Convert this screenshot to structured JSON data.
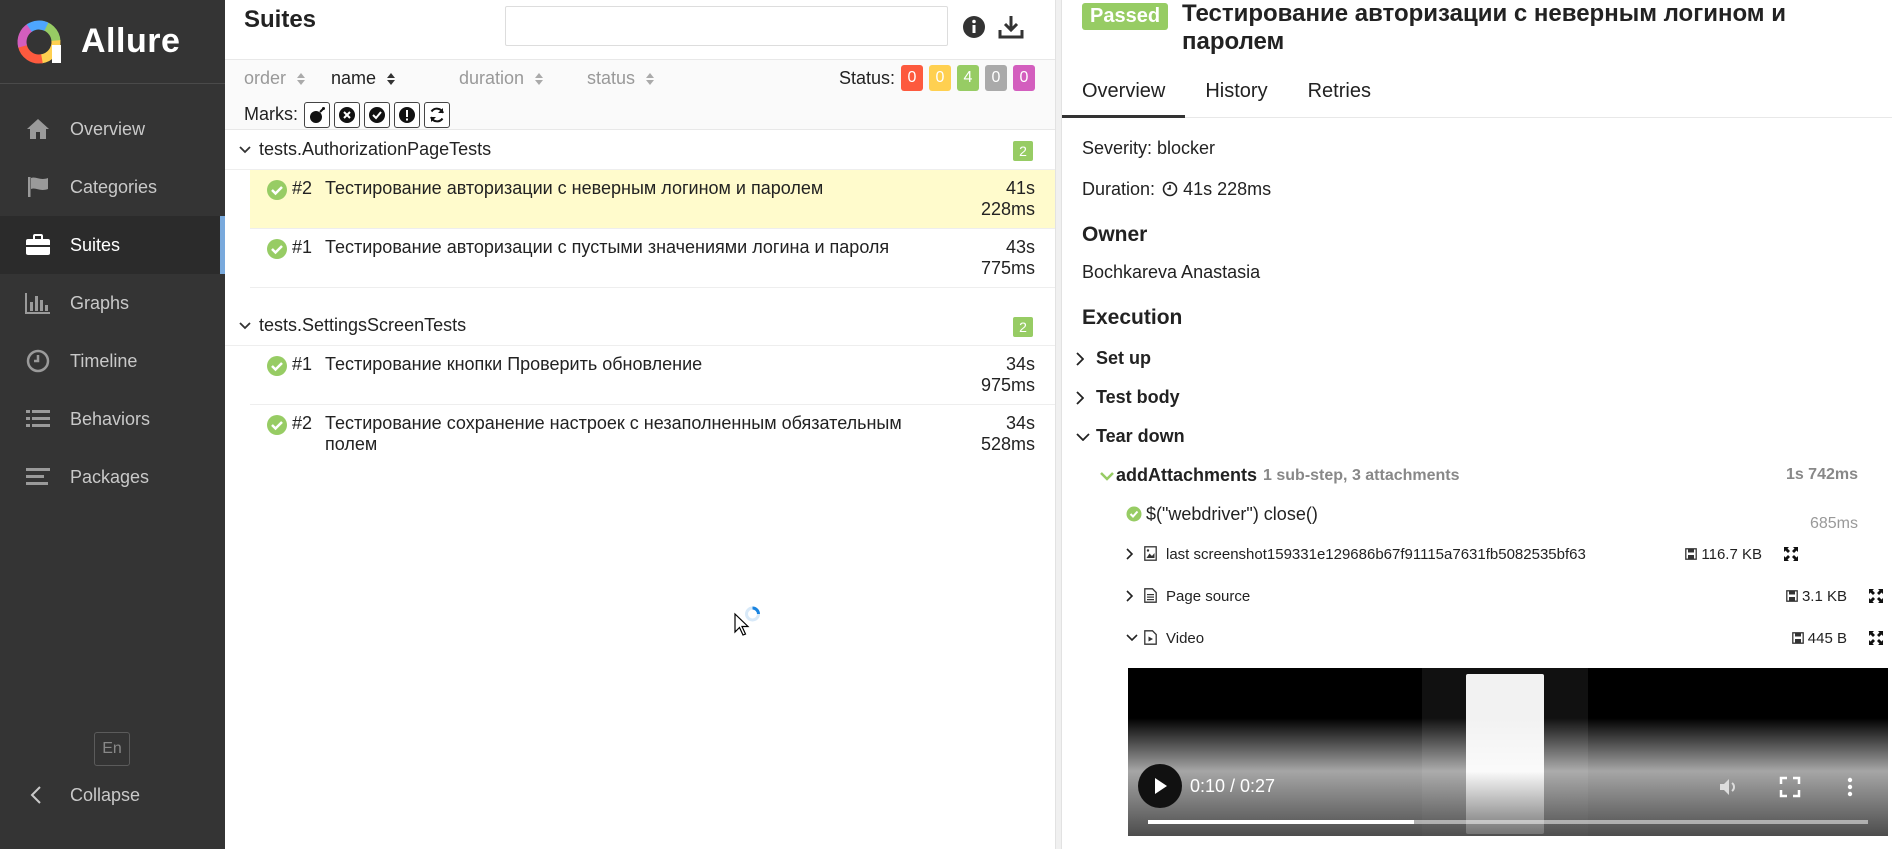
{
  "app": {
    "name": "Allure"
  },
  "sidebar": {
    "items": [
      {
        "label": "Overview",
        "icon": "home-icon"
      },
      {
        "label": "Categories",
        "icon": "flag-icon"
      },
      {
        "label": "Suites",
        "icon": "briefcase-icon",
        "active": true
      },
      {
        "label": "Graphs",
        "icon": "bar-chart-icon"
      },
      {
        "label": "Timeline",
        "icon": "clock-icon"
      },
      {
        "label": "Behaviors",
        "icon": "list-icon"
      },
      {
        "label": "Packages",
        "icon": "align-left-icon"
      }
    ],
    "language": "En",
    "collapse": "Collapse"
  },
  "suites": {
    "title": "Suites",
    "search_placeholder": "",
    "sort": {
      "order": "order",
      "name": "name",
      "duration": "duration",
      "status": "status"
    },
    "status_label": "Status:",
    "status_counts": [
      {
        "value": "0",
        "color": "#fd5a3e"
      },
      {
        "value": "0",
        "color": "#ffd050"
      },
      {
        "value": "4",
        "color": "#97cc64"
      },
      {
        "value": "0",
        "color": "#aaaaaa"
      },
      {
        "value": "0",
        "color": "#d35ebe"
      }
    ],
    "marks_label": "Marks:",
    "groups": [
      {
        "name": "tests.AuthorizationPageTests",
        "count": "2",
        "tests": [
          {
            "num": "#2",
            "name": "Тестирование авторизации с неверным логином и паролем",
            "duration": "41s 228ms",
            "selected": true
          },
          {
            "num": "#1",
            "name": "Тестирование авторизации с пустыми значениями логина и пароля",
            "duration": "43s 775ms"
          }
        ]
      },
      {
        "name": "tests.SettingsScreenTests",
        "count": "2",
        "tests": [
          {
            "num": "#1",
            "name": "Тестирование кнопки Проверить обновление",
            "duration": "34s 975ms"
          },
          {
            "num": "#2",
            "name": "Тестирование сохранение настроек с незаполненным обязательным полем",
            "duration": "34s 528ms"
          }
        ]
      }
    ]
  },
  "detail": {
    "status": "Passed",
    "title": "Тестирование авторизации с неверным логином и паролем",
    "tabs": [
      "Overview",
      "History",
      "Retries"
    ],
    "severity": "Severity: blocker",
    "duration_label": "Duration:",
    "duration": "41s 228ms",
    "owner_heading": "Owner",
    "owner": "Bochkareva Anastasia",
    "execution_heading": "Execution",
    "stages": {
      "setup": "Set up",
      "body": "Test body",
      "teardown": "Tear down"
    },
    "step": {
      "name": "addAttachments",
      "summary": "1 sub-step, 3 attachments",
      "duration": "1s 742ms",
      "substep": "$(\"webdriver\") close()",
      "substep_duration": "685ms"
    },
    "attachments": [
      {
        "name": "last screenshot159331e129686b67f91115a7631fb5082535bf63",
        "size": "116.7 KB"
      },
      {
        "name": "Page source",
        "size": "3.1 KB"
      },
      {
        "name": "Video",
        "size": "445 B"
      }
    ],
    "video": {
      "time": "0:10 / 0:27",
      "progress": 0.37
    }
  }
}
